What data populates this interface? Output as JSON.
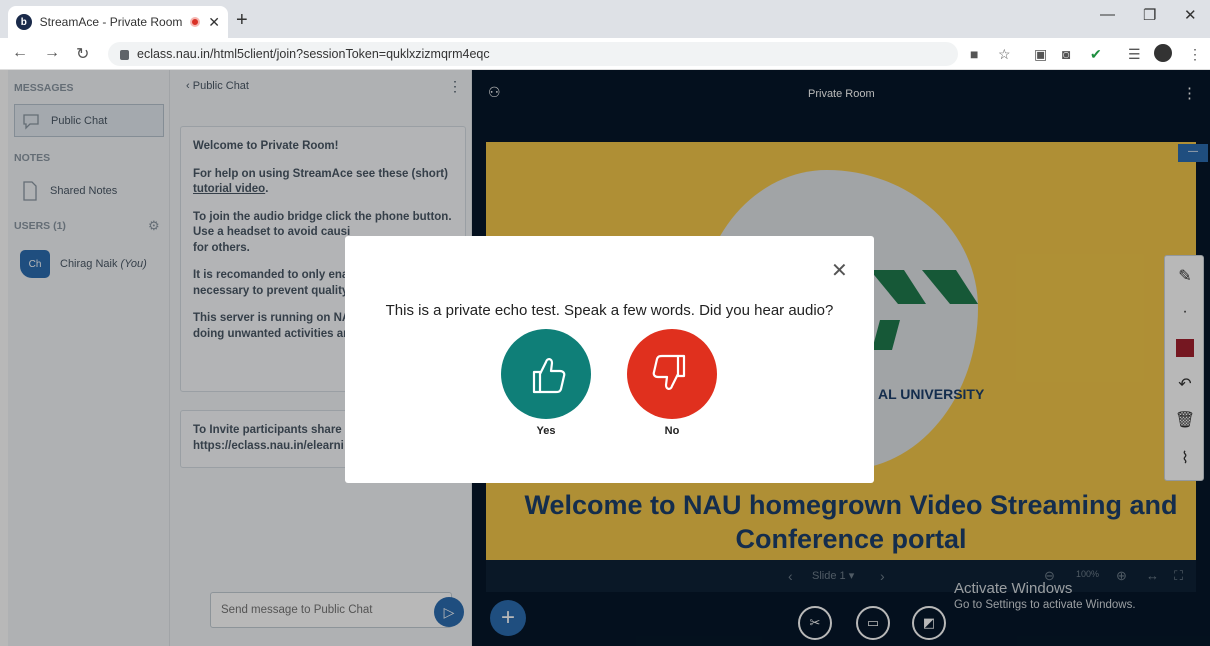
{
  "browser": {
    "tab_title": "StreamAce - Private Room",
    "favicon_letter": "b",
    "tab_close": "✕",
    "new_tab": "+",
    "url": "eclass.nau.in/html5client/join?sessionToken=quklxzizmqrm4eqc",
    "extension_badge": "0"
  },
  "sidebar": {
    "messages_header": "MESSAGES",
    "public_chat": "Public Chat",
    "notes_header": "NOTES",
    "shared_notes": "Shared Notes",
    "users_header": "USERS (1)",
    "user_initials": "Ch",
    "user_name": "Chirag Naik",
    "user_you": "(You)"
  },
  "chat": {
    "header": "Public Chat",
    "welcome_title": "Welcome to Private Room!",
    "help_line": "For help on using StreamAce see these (short)",
    "help_link": "tutorial video",
    "help_end": ".",
    "audio_line1": "To join the audio bridge click the phone button.",
    "audio_line2": "Use a headset to avoid causi",
    "audio_line3": "for others.",
    "recommend_line1": "It is recomanded to only enal",
    "recommend_line2": "necessary to prevent quality",
    "server_line1": "This server is running on NAU",
    "server_line2": "doing unwanted activities ar",
    "invite_line1": "To Invite participants share t",
    "invite_line2": "https://eclass.nau.in/elearni",
    "input_placeholder": "Send message to Public Chat"
  },
  "main": {
    "room_title": "Private Room",
    "slide_title": "Welcome to NAU homegrown Video Streaming and Conference portal",
    "university_fragment": "AL UNIVERSITY",
    "slide_label": "Slide 1",
    "zoom": "100%",
    "watermark_title": "Activate Windows",
    "watermark_sub": "Go to Settings to activate Windows."
  },
  "modal": {
    "question": "This is a private echo test. Speak a few words. Did you hear audio?",
    "yes_label": "Yes",
    "no_label": "No",
    "yes_color": "#0f7f78",
    "no_color": "#e0301e"
  }
}
